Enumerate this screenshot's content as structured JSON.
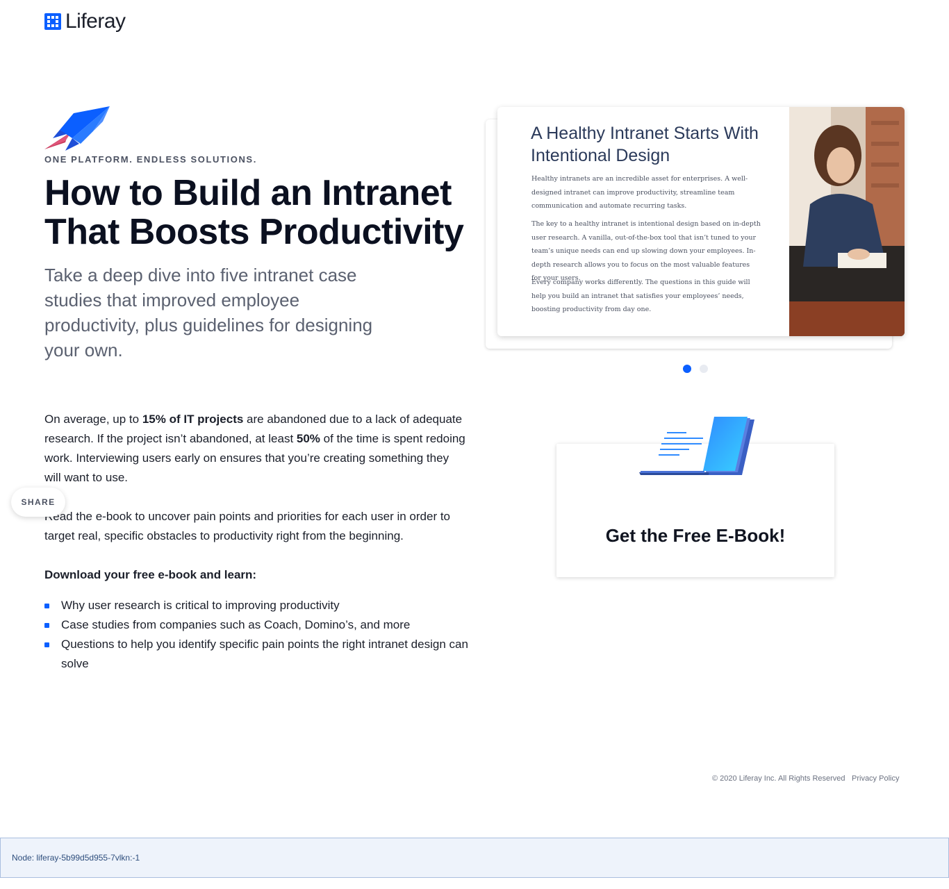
{
  "header": {
    "logo_text": "Liferay"
  },
  "hero": {
    "eyebrow": "ONE PLATFORM. ENDLESS SOLUTIONS.",
    "title": "How to Build an Intranet That Boosts Productivity",
    "subtitle": "Take a deep dive into five intranet case studies that improved employee productivity, plus guidelines for designing your own."
  },
  "content": {
    "p1_a": "On average, up to ",
    "p1_b": "15% of IT projects",
    "p1_c": " are abandoned due to a lack of adequate research. If the project isn’t abandoned, at least ",
    "p1_d": "50%",
    "p1_e": " of the time is spent redoing work. Interviewing users early on ensures that you’re creating something they will want to use.",
    "p2": "Read the e-book to uncover pain points and priorities for each user in order to target real, specific obstacles to productivity right from the beginning.",
    "learn_heading": "Download your free e-book and learn:",
    "list": [
      "Why user research is critical to improving productivity",
      "Case studies from companies such as Coach, Domino’s, and more",
      "Questions to help you identify specific pain points the right intranet design can solve"
    ]
  },
  "share": {
    "label": "SHARE"
  },
  "carousel": {
    "title": "A Healthy Intranet Starts With Intentional Design",
    "body1": "Healthy intranets are an incredible asset for enterprises. A well-designed intranet can improve productivity, streamline team communication and automate recurring tasks.",
    "body2": "The key to a healthy intranet is intentional design based on in-depth user research. A vanilla, out-of-the-box tool that isn’t tuned to your team’s unique needs can end up slowing down your employees. In-depth research allows you to focus on the most valuable features for your users.",
    "body3": "Every company works differently. The questions in this guide will help you build an intranet that satisfies your employees’ needs, boosting productivity from day one.",
    "active_slide": 1,
    "slide_count": 2
  },
  "ebook": {
    "cta": "Get the Free E-Book!"
  },
  "footer": {
    "copyright": "© 2020 Liferay Inc. All Rights Reserved",
    "privacy": "Privacy Policy"
  },
  "node_bar": {
    "text": "Node: liferay-5b99d5d955-7vlkn:-1"
  },
  "colors": {
    "accent": "#0b5fff",
    "heading": "#0b1020",
    "muted": "#5b6170"
  }
}
